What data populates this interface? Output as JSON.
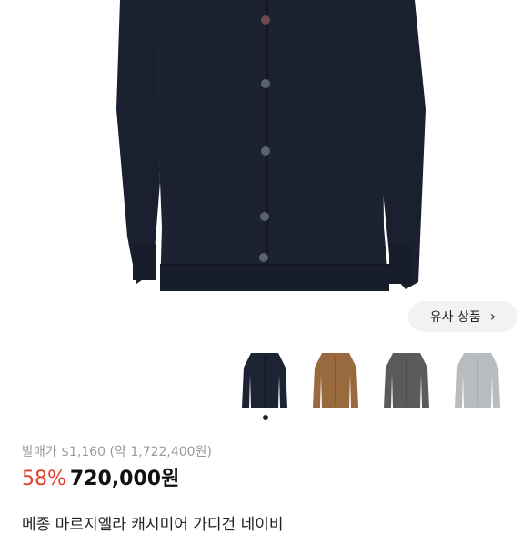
{
  "gallery": {
    "similar_button_label": "유사 상품",
    "thumbnails": [
      {
        "color_name": "navy",
        "color": "#1c2333"
      },
      {
        "color_name": "camel",
        "color": "#9a6a3f"
      },
      {
        "color_name": "charcoal",
        "color": "#5a5b5d"
      },
      {
        "color_name": "light-grey",
        "color": "#b9bcbf"
      }
    ],
    "active_index": 0
  },
  "product": {
    "original_price": "발매가 $1,160 (약 1,722,400원)",
    "discount": "58%",
    "price": "720,000원",
    "title": "메종 마르지엘라 캐시미어 가디건 네이비"
  },
  "colors": {
    "cardigan": "#1b2030",
    "button": "#5b6170",
    "discount": "#e0412f"
  }
}
